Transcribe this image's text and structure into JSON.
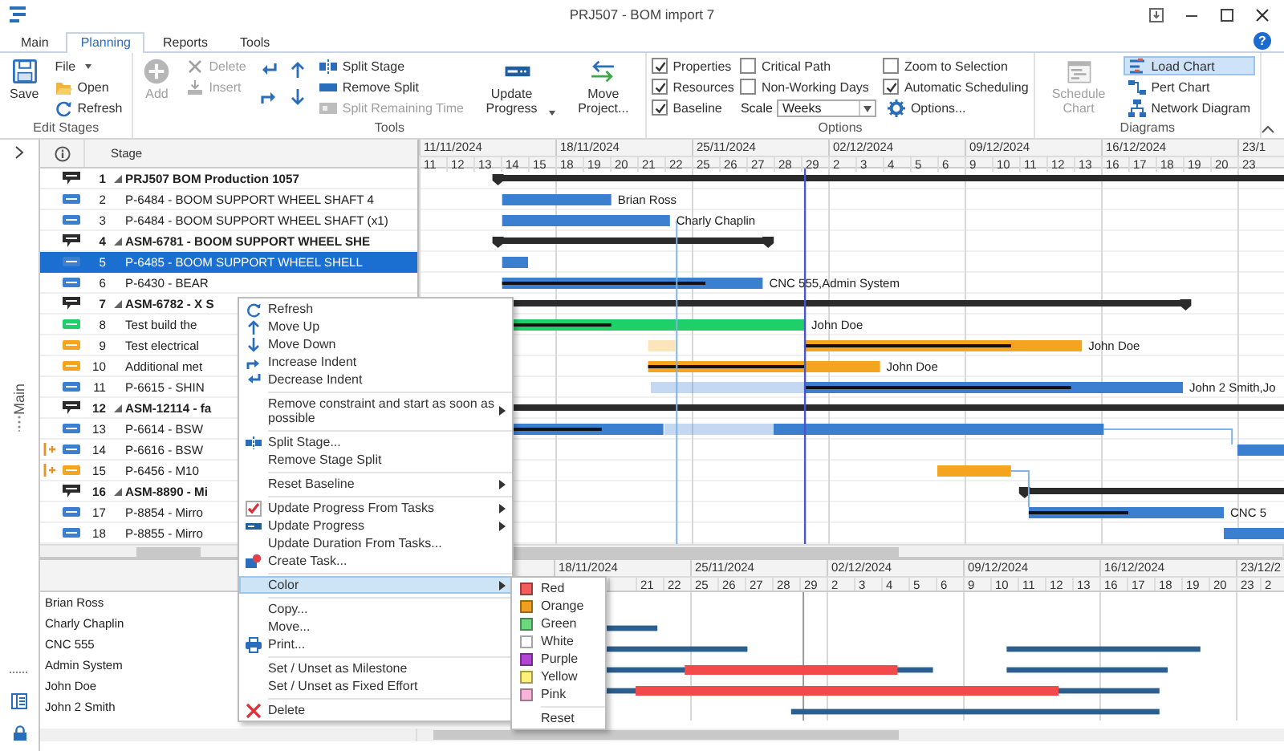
{
  "window": {
    "title": "PRJ507 - BOM import 7"
  },
  "tabs": [
    {
      "label": "Main",
      "selected": false
    },
    {
      "label": "Planning",
      "selected": true
    },
    {
      "label": "Reports",
      "selected": false
    },
    {
      "label": "Tools",
      "selected": false
    }
  ],
  "help": "?",
  "ribbon": {
    "groups": [
      {
        "title": "Edit Stages",
        "columns": [
          [
            {
              "kind": "large",
              "label": "Save",
              "disabled": false
            }
          ],
          [
            {
              "kind": "small",
              "label": "File",
              "dropdown": true,
              "disabled": false
            },
            {
              "kind": "small",
              "label": "Open",
              "disabled": false
            },
            {
              "kind": "small",
              "label": "Refresh",
              "disabled": false
            }
          ]
        ]
      },
      {
        "title": "Tools",
        "columns": [
          [
            {
              "kind": "large",
              "label": "Add",
              "disabled": true
            }
          ],
          [
            {
              "kind": "small",
              "label": "Delete",
              "disabled": true
            },
            {
              "kind": "small",
              "label": "Insert",
              "disabled": true
            }
          ],
          [
            {
              "kind": "icon",
              "disabled": false
            },
            {
              "kind": "icon",
              "disabled": false
            }
          ],
          [
            {
              "kind": "icon",
              "disabled": false
            },
            {
              "kind": "icon",
              "disabled": false
            }
          ],
          [
            {
              "kind": "small",
              "label": "Split Stage",
              "disabled": false
            },
            {
              "kind": "small",
              "label": "Remove Split",
              "disabled": false
            },
            {
              "kind": "small",
              "label": "Split Remaining Time",
              "disabled": true
            }
          ],
          [
            {
              "kind": "large",
              "label": "Update Progress",
              "dropdown": true,
              "disabled": false
            }
          ],
          [
            {
              "kind": "large",
              "label": "Move Project...",
              "disabled": false
            }
          ]
        ]
      },
      {
        "title": "Options",
        "columns": [
          [
            {
              "kind": "check",
              "label": "Properties",
              "checked": true
            },
            {
              "kind": "check",
              "label": "Resources",
              "checked": true
            },
            {
              "kind": "check",
              "label": "Baseline",
              "checked": true
            }
          ],
          [
            {
              "kind": "check",
              "label": "Critical Path",
              "checked": false
            },
            {
              "kind": "check",
              "label": "Non-Working Days",
              "checked": false
            },
            {
              "kind": "combo",
              "label": "Scale",
              "value": "Weeks"
            }
          ],
          [
            {
              "kind": "check",
              "label": "Zoom to Selection",
              "checked": false
            },
            {
              "kind": "check",
              "label": "Automatic Scheduling",
              "checked": true
            },
            {
              "kind": "small",
              "label": "Options...",
              "disabled": false
            }
          ]
        ]
      },
      {
        "title": "Diagrams",
        "columns": [
          [
            {
              "kind": "large",
              "label": "Schedule Chart",
              "disabled": true,
              "selected": false
            }
          ],
          [
            {
              "kind": "small",
              "label": "Load Chart",
              "disabled": false,
              "selected": true
            },
            {
              "kind": "small",
              "label": "Pert Chart",
              "disabled": false,
              "selected": false
            },
            {
              "kind": "small",
              "label": "Network Diagram",
              "disabled": false,
              "selected": false
            }
          ]
        ]
      }
    ]
  },
  "side_panel": {
    "label": "Main"
  },
  "stage_header": "Stage",
  "rows": [
    {
      "number": "1",
      "stage": "PRJ507 BOM Production 1057",
      "kind": "summary",
      "color": "#2b2b2b",
      "selected": false,
      "constraint": false
    },
    {
      "number": "2",
      "stage": "P-6484 - BOOM SUPPORT WHEEL SHAFT 4",
      "kind": "task",
      "color": "#3b7fd1",
      "selected": false,
      "constraint": false,
      "bar_label": "Brian Ross"
    },
    {
      "number": "3",
      "stage": "P-6484 - BOOM SUPPORT WHEEL SHAFT (x1)",
      "kind": "task",
      "color": "#3b7fd1",
      "selected": false,
      "constraint": false,
      "bar_label": "Charly Chaplin"
    },
    {
      "number": "4",
      "stage": "ASM-6781 - BOOM SUPPORT WHEEL SHE",
      "kind": "summary",
      "color": "#2b2b2b",
      "selected": false,
      "constraint": false
    },
    {
      "number": "5",
      "stage": "P-6485 - BOOM SUPPORT WHEEL SHELL",
      "kind": "task",
      "color": "#3b7fd1",
      "selected": true,
      "constraint": false
    },
    {
      "number": "6",
      "stage": "P-6430 - BEAR",
      "kind": "task",
      "color": "#3b7fd1",
      "selected": false,
      "constraint": false,
      "bar_label": "CNC 555,Admin System"
    },
    {
      "number": "7",
      "stage": "ASM-6782 - X S",
      "kind": "summary",
      "color": "#2b2b2b",
      "selected": false,
      "constraint": false
    },
    {
      "number": "8",
      "stage": "Test build the",
      "kind": "task",
      "color": "#1fcf6a",
      "selected": false,
      "constraint": false,
      "bar_label": "John Doe"
    },
    {
      "number": "9",
      "stage": "Test electrical",
      "kind": "task",
      "color": "#f4a41e",
      "selected": false,
      "constraint": false,
      "bar_label": "John Doe"
    },
    {
      "number": "10",
      "stage": "Additional met",
      "kind": "task",
      "color": "#f4a41e",
      "selected": false,
      "constraint": false,
      "bar_label": "John Doe"
    },
    {
      "number": "11",
      "stage": "P-6615 - SHIN",
      "kind": "task",
      "color": "#3b7fd1",
      "selected": false,
      "constraint": false,
      "bar_label": "John 2 Smith,Jo"
    },
    {
      "number": "12",
      "stage": "ASM-12114 - fa",
      "kind": "summary",
      "color": "#2b2b2b",
      "selected": false,
      "constraint": false
    },
    {
      "number": "13",
      "stage": "P-6614 - BSW",
      "kind": "task",
      "color": "#3b7fd1",
      "selected": false,
      "constraint": false
    },
    {
      "number": "14",
      "stage": "P-6616 - BSW",
      "kind": "task",
      "color": "#3b7fd1",
      "selected": false,
      "constraint": true
    },
    {
      "number": "15",
      "stage": "P-6456 - M10",
      "kind": "task",
      "color": "#f4a41e",
      "selected": false,
      "constraint": true
    },
    {
      "number": "16",
      "stage": "ASM-8890 - Mi",
      "kind": "summary",
      "color": "#2b2b2b",
      "selected": false,
      "constraint": false
    },
    {
      "number": "17",
      "stage": "P-8854 - Mirro",
      "kind": "task",
      "color": "#3b7fd1",
      "selected": false,
      "constraint": false,
      "bar_label": "CNC 5"
    },
    {
      "number": "18",
      "stage": "P-8855 - Mirro",
      "kind": "task",
      "color": "#3b7fd1",
      "selected": false,
      "constraint": false
    }
  ],
  "timeline": {
    "weeks": [
      {
        "label": "11/11/2024",
        "days": [
          "11",
          "12",
          "13",
          "14",
          "15"
        ]
      },
      {
        "label": "18/11/2024",
        "days": [
          "18",
          "19",
          "20",
          "21",
          "22"
        ]
      },
      {
        "label": "25/11/2024",
        "days": [
          "25",
          "26",
          "27",
          "28",
          "29"
        ]
      },
      {
        "label": "02/12/2024",
        "days": [
          "2",
          "3",
          "4",
          "5",
          "6"
        ]
      },
      {
        "label": "09/12/2024",
        "days": [
          "9",
          "10",
          "11",
          "12",
          "13"
        ]
      },
      {
        "label": "16/12/2024",
        "days": [
          "16",
          "17",
          "18",
          "19",
          "20"
        ]
      },
      {
        "label": "23/1",
        "days": [
          "23"
        ]
      }
    ]
  },
  "load_timeline": {
    "weeks": [
      {
        "label": "18/11/2024",
        "days": [
          "21",
          "22"
        ]
      },
      {
        "label": "25/11/2024",
        "days": [
          "25",
          "26",
          "27",
          "28",
          "29"
        ]
      },
      {
        "label": "02/12/2024",
        "days": [
          "2",
          "3",
          "4",
          "5",
          "6"
        ]
      },
      {
        "label": "09/12/2024",
        "days": [
          "9",
          "10",
          "11",
          "12",
          "13"
        ]
      },
      {
        "label": "16/12/2024",
        "days": [
          "16",
          "17",
          "18",
          "19",
          "20"
        ]
      },
      {
        "label": "23/12/2",
        "days": [
          "23",
          "2"
        ]
      }
    ]
  },
  "resources": [
    {
      "name": "Brian Ross"
    },
    {
      "name": "Charly Chaplin"
    },
    {
      "name": "CNC 555"
    },
    {
      "name": "Admin System"
    },
    {
      "name": "John Doe"
    },
    {
      "name": "John 2 Smith"
    }
  ],
  "context_menu": {
    "groups": [
      [
        {
          "label": "Refresh",
          "submenu": false,
          "selected": false
        },
        {
          "label": "Move Up",
          "submenu": false,
          "selected": false
        },
        {
          "label": "Move Down",
          "submenu": false,
          "selected": false
        },
        {
          "label": "Increase Indent",
          "submenu": false,
          "selected": false
        },
        {
          "label": "Decrease Indent",
          "submenu": false,
          "selected": false
        }
      ],
      [
        {
          "label": "Remove constraint and start as soon as possible",
          "submenu": true,
          "selected": false
        }
      ],
      [
        {
          "label": "Split Stage...",
          "submenu": false,
          "selected": false
        },
        {
          "label": "Remove Stage Split",
          "submenu": false,
          "selected": false
        }
      ],
      [
        {
          "label": "Reset Baseline",
          "submenu": true,
          "selected": false
        }
      ],
      [
        {
          "label": "Update Progress From Tasks",
          "submenu": true,
          "selected": false
        },
        {
          "label": "Update Progress",
          "submenu": true,
          "selected": false
        },
        {
          "label": "Update Duration From Tasks...",
          "submenu": false,
          "selected": false
        },
        {
          "label": "Create Task...",
          "submenu": false,
          "selected": false
        }
      ],
      [
        {
          "label": "Color",
          "submenu": true,
          "selected": true
        }
      ],
      [
        {
          "label": "Copy...",
          "submenu": false,
          "selected": false
        },
        {
          "label": "Move...",
          "submenu": false,
          "selected": false
        },
        {
          "label": "Print...",
          "submenu": false,
          "selected": false
        }
      ],
      [
        {
          "label": "Set / Unset as Milestone",
          "submenu": false,
          "selected": false
        },
        {
          "label": "Set / Unset as Fixed Effort",
          "submenu": false,
          "selected": false
        }
      ],
      [
        {
          "label": "Delete",
          "submenu": false,
          "selected": false
        }
      ]
    ]
  },
  "color_submenu": {
    "groups": [
      [
        {
          "label": "Red",
          "color": "#f25c5c"
        },
        {
          "label": "Orange",
          "color": "#f0a01e"
        },
        {
          "label": "Green",
          "color": "#6cd87e"
        },
        {
          "label": "White",
          "color": "#ffffff"
        },
        {
          "label": "Purple",
          "color": "#b444d4"
        },
        {
          "label": "Yellow",
          "color": "#fff07a"
        },
        {
          "label": "Pink",
          "color": "#f8b4d8"
        }
      ],
      [
        {
          "label": "Reset"
        }
      ]
    ]
  }
}
